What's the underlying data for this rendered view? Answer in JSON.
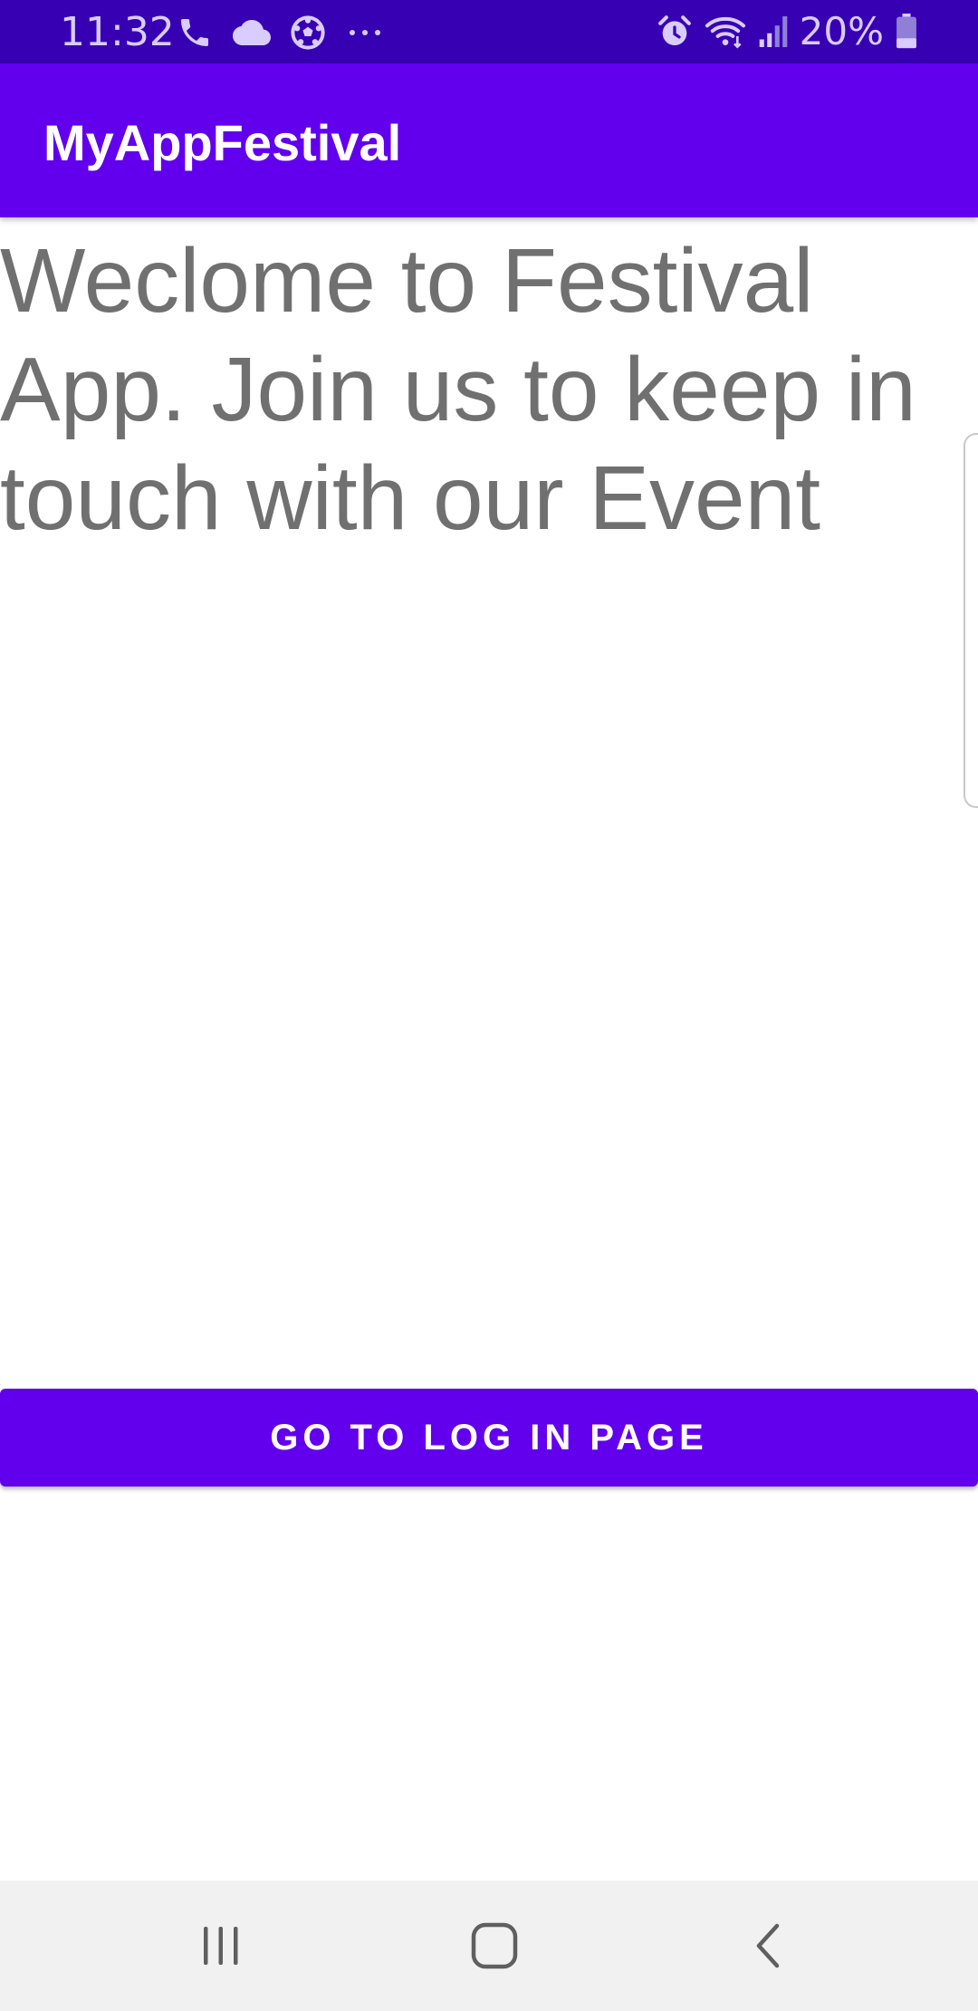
{
  "status_bar": {
    "time": "11:32",
    "left_icons": [
      "phone-icon",
      "cloud-icon",
      "soccer-ball-icon",
      "more-dots-icon"
    ],
    "right_icons": [
      "alarm-icon",
      "wifi-icon",
      "signal-icon",
      "battery-icon"
    ],
    "battery_text": "20%",
    "colors": {
      "background": "#3700b3",
      "foreground": "#d9ccff"
    }
  },
  "app_bar": {
    "title": "MyAppFestival",
    "color": "#6200ee"
  },
  "main": {
    "welcome_text": "Weclome to Festival App. Join us to keep in touch with our Event",
    "text_color": "#707070"
  },
  "actions": {
    "login_button_label": "GO TO LOG IN PAGE",
    "button_color": "#6200ee"
  },
  "nav_bar": {
    "buttons": [
      "recents-icon",
      "home-icon",
      "back-icon"
    ],
    "background": "#f1f1f1"
  }
}
